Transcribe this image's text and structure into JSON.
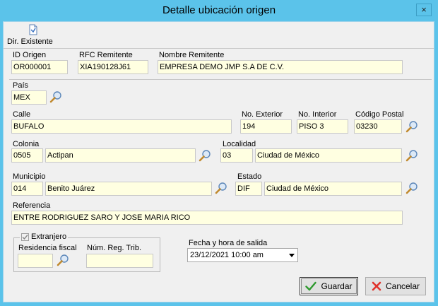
{
  "window": {
    "title": "Detalle ubicación origen",
    "close_glyph": "×"
  },
  "toolbar": {
    "dir_existente_label": "Dir. Existente",
    "icon": "document-icon"
  },
  "form": {
    "id_origen": {
      "label": "ID Origen",
      "value": "OR000001"
    },
    "rfc_remitente": {
      "label": "RFC Remitente",
      "value": "XIA190128J61"
    },
    "nombre_remitente": {
      "label": "Nombre Remitente",
      "value": "EMPRESA DEMO JMP S.A DE C.V."
    },
    "pais": {
      "label": "País",
      "value": "MEX"
    },
    "calle": {
      "label": "Calle",
      "value": "BUFALO"
    },
    "no_exterior": {
      "label": "No. Exterior",
      "value": "194"
    },
    "no_interior": {
      "label": "No. Interior",
      "value": "PISO 3"
    },
    "codigo_postal": {
      "label": "Código Postal",
      "value": "03230"
    },
    "colonia": {
      "label": "Colonia",
      "code": "0505",
      "name": "Actipan"
    },
    "localidad": {
      "label": "Localidad",
      "code": "03",
      "name": "Ciudad de México"
    },
    "municipio": {
      "label": "Municipio",
      "code": "014",
      "name": "Benito Juárez"
    },
    "estado": {
      "label": "Estado",
      "code": "DIF",
      "name": "Ciudad de México"
    },
    "referencia": {
      "label": "Referencia",
      "value": "ENTRE RODRIGUEZ SARO Y JOSE MARIA RICO"
    },
    "extranjero": {
      "label": "Extranjero",
      "checked": true
    },
    "residencia_fiscal": {
      "label": "Residencia fiscal",
      "value": ""
    },
    "num_reg_trib": {
      "label": "Núm. Reg. Trib.",
      "value": ""
    },
    "fecha_salida": {
      "label": "Fecha y hora de salida",
      "value": "23/12/2021 10:00 am"
    }
  },
  "buttons": {
    "guardar": "Guardar",
    "cancelar": "Cancelar"
  },
  "colors": {
    "titlebar": "#5bc3ea",
    "field_bg": "#ffffe1",
    "panel": "#f0f0f0",
    "cancel_x": "#e0322b",
    "guardar_check": "#2f9a2f"
  }
}
